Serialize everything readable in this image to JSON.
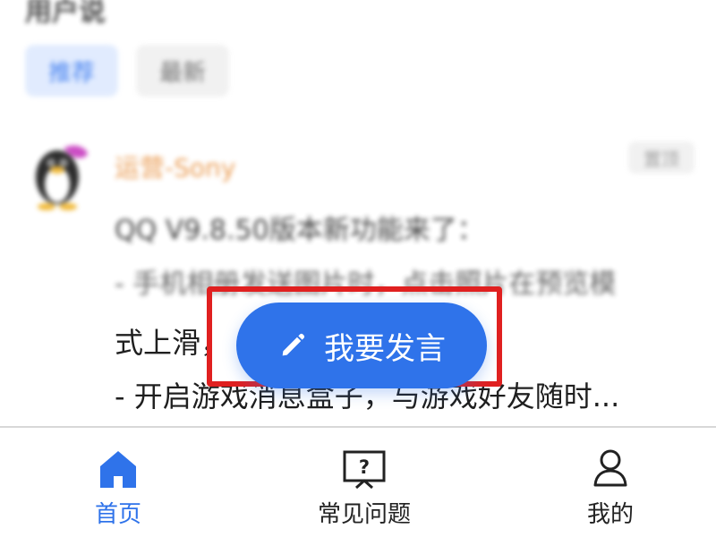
{
  "header": {
    "section_title": "用户说",
    "filters": [
      {
        "label": "推荐",
        "active": true
      },
      {
        "label": "最新",
        "active": false
      }
    ]
  },
  "post": {
    "author": "运营-Sony",
    "tag": "置顶",
    "lines": [
      "QQ V9.8.50版本新功能来了：",
      "- 手机相册发送图片时，点击照片在预览模",
      "式上滑，",
      "- 开启游戏消息盒子，与游戏好友随时..."
    ]
  },
  "fab": {
    "label": "我要发言",
    "icon": "pencil-icon"
  },
  "highlight": {
    "color": "#e02020"
  },
  "bottom_nav": {
    "items": [
      {
        "label": "首页",
        "icon": "home-icon",
        "active": true
      },
      {
        "label": "常见问题",
        "icon": "question-icon",
        "active": false
      },
      {
        "label": "我的",
        "icon": "user-icon",
        "active": false
      }
    ]
  },
  "colors": {
    "accent": "#2f73ea",
    "author": "#e9974a",
    "chip_active_bg": "#dfeafe"
  }
}
